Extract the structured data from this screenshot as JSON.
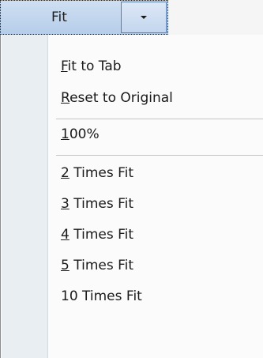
{
  "split_button": {
    "label": "Fit",
    "arrow_icon": "chevron-down-icon"
  },
  "menu": {
    "items": [
      {
        "mnemonic": "F",
        "rest": "it to Tab"
      },
      {
        "mnemonic": "R",
        "rest": "eset to Original"
      },
      {
        "mnemonic": "1",
        "rest": "00%"
      },
      {
        "mnemonic": "2",
        "rest": " Times Fit"
      },
      {
        "mnemonic": "3",
        "rest": " Times Fit"
      },
      {
        "mnemonic": "4",
        "rest": " Times Fit"
      },
      {
        "mnemonic": "5",
        "rest": " Times Fit"
      },
      {
        "mnemonic": "",
        "rest": "10 Times Fit"
      }
    ]
  },
  "colors": {
    "button_bg": "#c3d6ee",
    "menu_gutter": "#e9eef3",
    "separator": "#c5c5c5"
  }
}
